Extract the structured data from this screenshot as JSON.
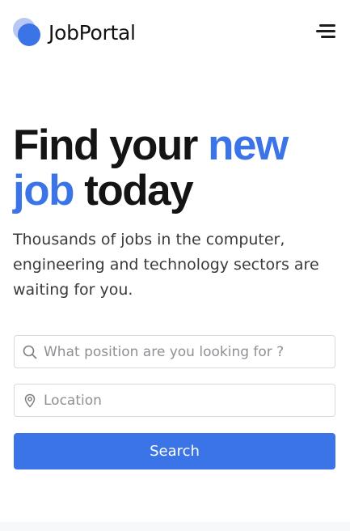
{
  "header": {
    "brand": "JobPortal",
    "menu_icon": "hamburger-menu-icon",
    "accent_color": "#3b74e6"
  },
  "hero": {
    "title_part1": "Find your ",
    "title_accent1": "new",
    "title_accent2": "job",
    "title_part2": " today",
    "subtitle": "Thousands of jobs in the computer, engineering and technology sectors are waiting for you."
  },
  "search": {
    "position_placeholder": "What position are you looking for ?",
    "position_value": "",
    "position_icon": "search-icon",
    "location_placeholder": "Location",
    "location_value": "",
    "location_icon": "location-pin-icon",
    "button_label": "Search"
  }
}
